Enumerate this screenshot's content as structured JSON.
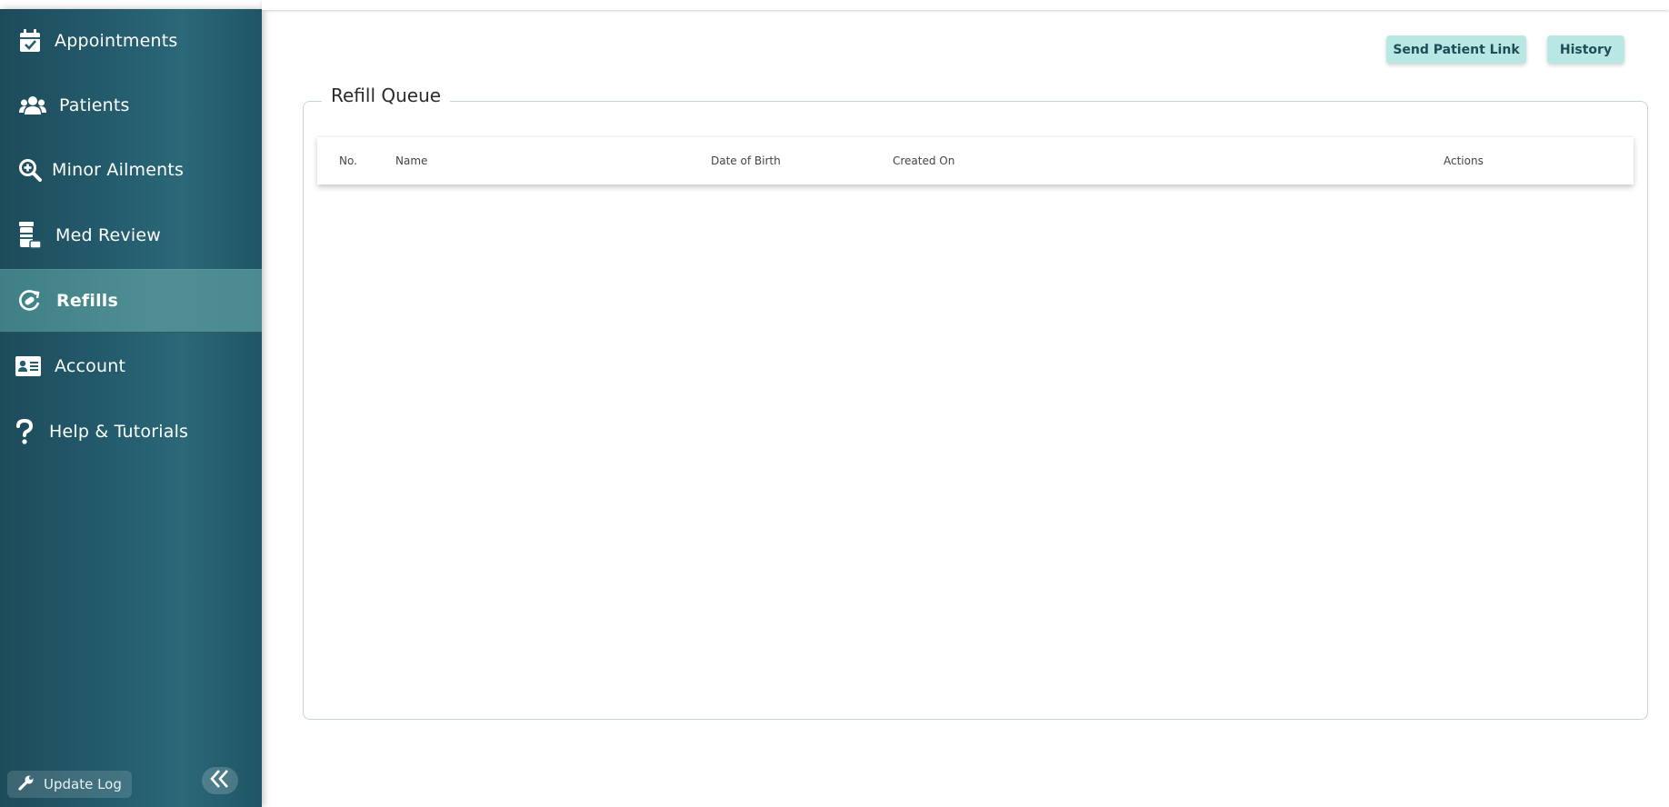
{
  "sidebar": {
    "items": [
      {
        "label": "Appointments",
        "icon": "calendar-check-icon"
      },
      {
        "label": "Patients",
        "icon": "users-icon"
      },
      {
        "label": "Minor Ailments",
        "icon": "search-plus-icon"
      },
      {
        "label": "Med Review",
        "icon": "prescription-bottle-icon"
      },
      {
        "label": "Refills",
        "icon": "refill-cycle-icon",
        "active": true
      },
      {
        "label": "Account",
        "icon": "id-card-icon"
      },
      {
        "label": "Help & Tutorials",
        "icon": "question-icon"
      }
    ],
    "update_log_label": "Update Log",
    "colors": {
      "background": "#245d6e",
      "active": "#4a8b91"
    }
  },
  "header": {
    "send_patient_link_label": "Send Patient Link",
    "history_label": "History",
    "button_color": "#b9e8e4"
  },
  "refill_queue": {
    "title": "Refill Queue",
    "columns": [
      "No.",
      "Name",
      "Date of Birth",
      "Created On",
      "Actions"
    ],
    "rows": []
  }
}
